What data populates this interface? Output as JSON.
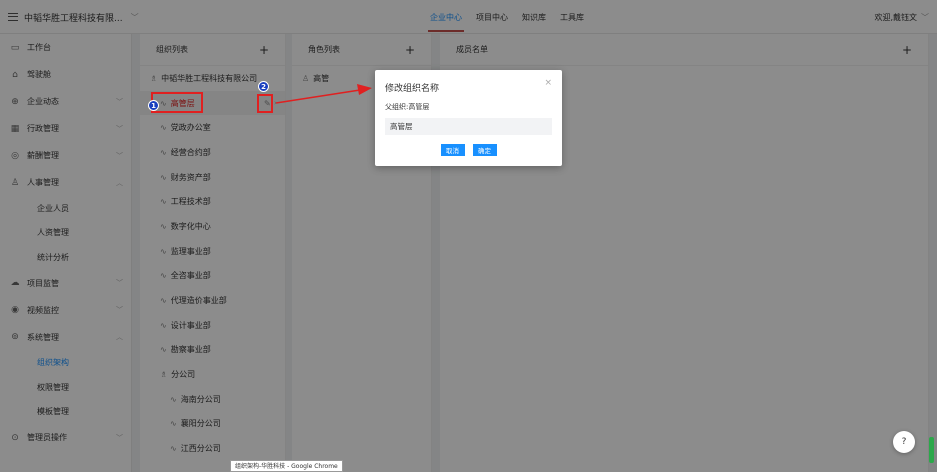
{
  "topbar": {
    "company": "中韬华胜工程科技有限...",
    "tabs": [
      "企业中心",
      "项目中心",
      "知识库",
      "工具库"
    ],
    "user": "欢迎,戴钰文"
  },
  "sidebar": {
    "items": [
      {
        "label": "工作台",
        "icon": "desktop-icon",
        "glyph": "▭"
      },
      {
        "label": "驾驶舱",
        "icon": "home-icon",
        "glyph": "⌂"
      },
      {
        "label": "企业动态",
        "icon": "globe-icon",
        "glyph": "⊕"
      },
      {
        "label": "行政管理",
        "icon": "grid-icon",
        "glyph": "▦"
      },
      {
        "label": "薪酬管理",
        "icon": "money-icon",
        "glyph": "◎"
      },
      {
        "label": "人事管理",
        "icon": "user-icon",
        "glyph": "♙"
      }
    ],
    "hr_subs": [
      "企业人员",
      "人资管理",
      "统计分析"
    ],
    "items2": [
      {
        "label": "项目监管",
        "icon": "cloud-icon",
        "glyph": "☁"
      },
      {
        "label": "视频监控",
        "icon": "camera-icon",
        "glyph": "◉"
      },
      {
        "label": "系统管理",
        "icon": "settings-icon",
        "glyph": "⊚"
      }
    ],
    "sys_subs": [
      "组织架构",
      "权限管理",
      "模板管理"
    ],
    "items3": [
      {
        "label": "管理员操作",
        "icon": "admin-icon",
        "glyph": "⊙"
      }
    ]
  },
  "org_panel": {
    "title": "组织列表",
    "root": "中韬华胜工程科技有限公司",
    "selected": "高管层",
    "children": [
      "党政办公室",
      "经营合约部",
      "财务资产部",
      "工程技术部",
      "数字化中心",
      "监理事业部",
      "全咨事业部",
      "代理造价事业部",
      "设计事业部",
      "勘察事业部"
    ],
    "branch": "分公司",
    "branch_children": [
      "海南分公司",
      "襄阳分公司",
      "江西分公司"
    ]
  },
  "role_panel": {
    "title": "角色列表",
    "roles": [
      "高管"
    ]
  },
  "member_panel": {
    "title": "成员名单"
  },
  "dialog": {
    "title": "修改组织名称",
    "parent_label": "父组织:高管层",
    "input_value": "高管层",
    "cancel": "取消",
    "confirm": "确定"
  },
  "annotations": {
    "badge1": "1",
    "badge2": "2"
  },
  "tooltip": "组织架构-华胜科技 - Google Chrome",
  "help": "?"
}
